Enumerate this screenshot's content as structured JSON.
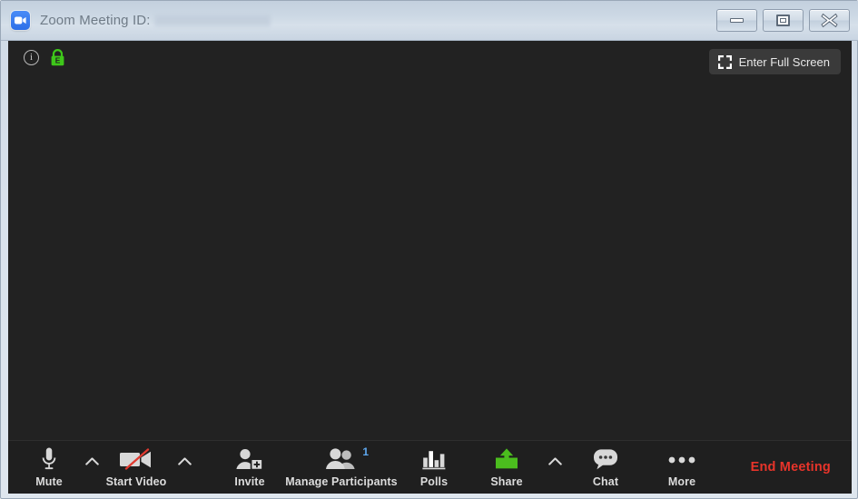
{
  "window": {
    "title_prefix": "Zoom Meeting ID:",
    "meeting_id_redacted": true,
    "controls": {
      "minimize_label": "Minimize",
      "restore_label": "Restore",
      "close_label": "Close"
    }
  },
  "stage": {
    "info_glyph": "i",
    "lock_letter": "E",
    "fullscreen_button_label": "Enter Full Screen",
    "background_color": "#222222"
  },
  "toolbar": {
    "background_color": "#1f1f1f",
    "items": [
      {
        "label": "Mute",
        "icon": "microphone-icon",
        "has_chevron": true
      },
      {
        "label": "Start Video",
        "icon": "video-off-icon",
        "has_chevron": true
      },
      {
        "label": "Invite",
        "icon": "invite-person-add-icon",
        "has_chevron": false
      },
      {
        "label": "Manage Participants",
        "icon": "participants-icon",
        "has_chevron": false,
        "badge": "1"
      },
      {
        "label": "Polls",
        "icon": "poll-bar-chart-icon",
        "has_chevron": false
      },
      {
        "label": "Share",
        "icon": "share-screen-icon",
        "has_chevron": true
      },
      {
        "label": "Chat",
        "icon": "chat-bubble-icon",
        "has_chevron": false
      },
      {
        "label": "More",
        "icon": "more-dots-icon",
        "has_chevron": false
      }
    ],
    "end_meeting_label": "End Meeting",
    "end_meeting_color": "#e8342a"
  },
  "colors": {
    "titlebar": "#ccd8e4",
    "stage": "#222222",
    "toolbar": "#1f1f1f",
    "share_green": "#4bbd1e",
    "lock_green": "#3ec71a",
    "badge_blue": "#5ea8ef",
    "end_red": "#e8342a"
  }
}
